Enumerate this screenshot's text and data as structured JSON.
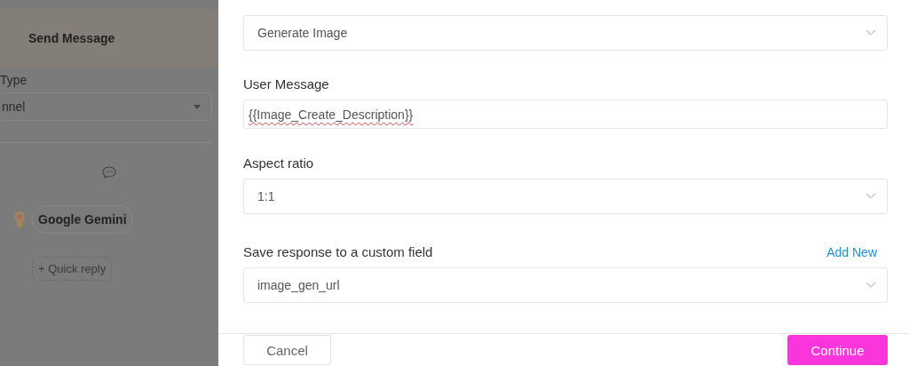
{
  "background_panel": {
    "title": "Send Message",
    "type_label": "Type",
    "type_value": "nnel",
    "bot_name": "Google Gemini",
    "quick_reply": "+ Quick reply"
  },
  "modal": {
    "fields": [
      {
        "kind": "select",
        "value": "Generate Image"
      },
      {
        "kind": "text",
        "label": "User Message",
        "value": "{{Image_Create_Description}}"
      },
      {
        "kind": "select",
        "label": "Aspect ratio",
        "value": "1:1"
      },
      {
        "kind": "select",
        "label": "Save response to a custom field",
        "link": "Add New",
        "value": "image_gen_url"
      }
    ],
    "buttons": [
      {
        "kind": "secondary",
        "label": "Cancel"
      },
      {
        "kind": "primary",
        "label": "Continue"
      }
    ]
  }
}
